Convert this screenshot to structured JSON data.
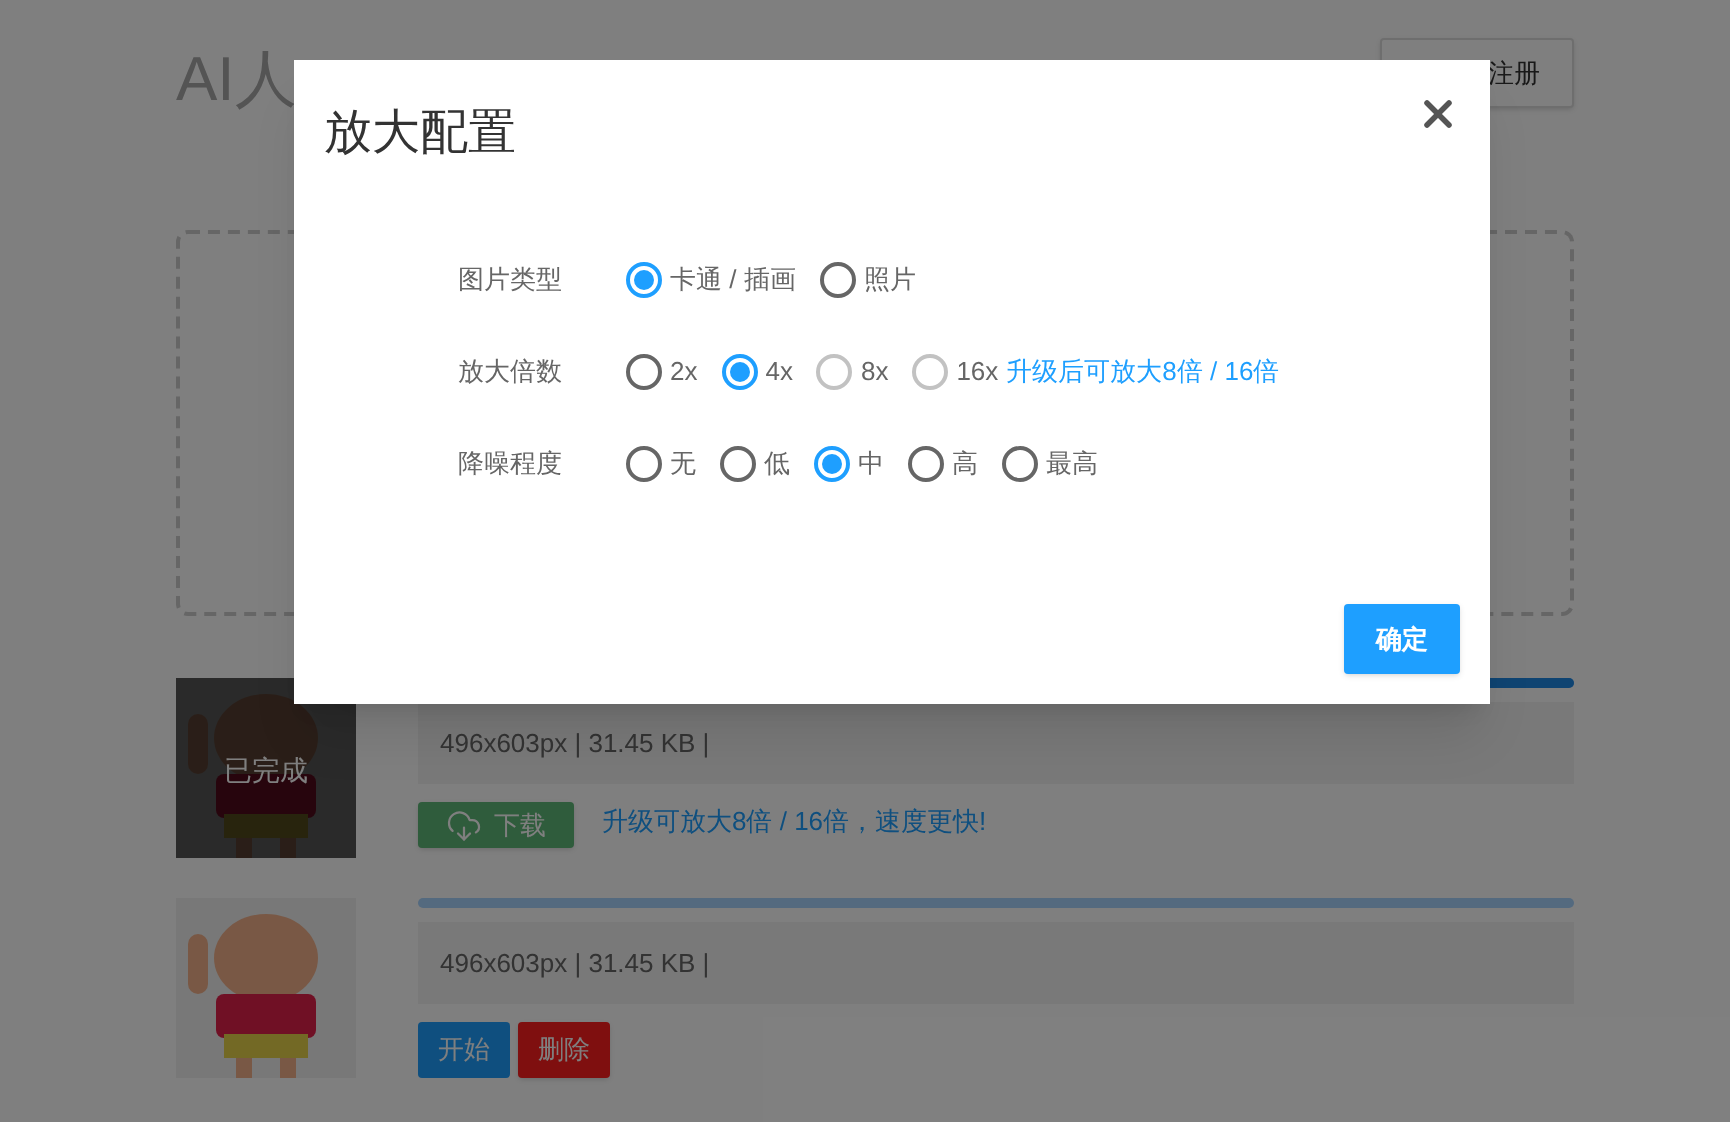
{
  "page": {
    "title": "AI人",
    "register_button": "注册"
  },
  "files": [
    {
      "completed": true,
      "status": "已完成",
      "progress": {
        "level": 1
      },
      "info": "496x603px | 31.45 KB |",
      "actions": [
        {
          "kind": "download",
          "label": "下载"
        },
        {
          "kind": "link",
          "label": "升级可放大8倍 / 16倍，速度更快!"
        }
      ]
    },
    {
      "completed": false,
      "progress": {
        "level": 0
      },
      "info": "496x603px | 31.45 KB |",
      "actions": [
        {
          "kind": "start",
          "label": "开始"
        },
        {
          "kind": "delete",
          "label": "删除"
        }
      ]
    }
  ],
  "dialog": {
    "title": "放大配置",
    "rows": [
      {
        "label": "图片类型",
        "options": [
          {
            "label": "卡通 / 插画",
            "selected": true,
            "disabled": false
          },
          {
            "label": "照片",
            "selected": false,
            "disabled": false
          }
        ]
      },
      {
        "label": "放大倍数",
        "options": [
          {
            "label": "2x",
            "selected": false,
            "disabled": false
          },
          {
            "label": "4x",
            "selected": true,
            "disabled": false
          },
          {
            "label": "8x",
            "selected": false,
            "disabled": true
          },
          {
            "label": "16x",
            "selected": false,
            "disabled": true
          }
        ],
        "note": "升级后可放大8倍 / 16倍"
      },
      {
        "label": "降噪程度",
        "options": [
          {
            "label": "无",
            "selected": false,
            "disabled": false
          },
          {
            "label": "低",
            "selected": false,
            "disabled": false
          },
          {
            "label": "中",
            "selected": true,
            "disabled": false
          },
          {
            "label": "高",
            "selected": false,
            "disabled": false
          },
          {
            "label": "最高",
            "selected": false,
            "disabled": false
          }
        ]
      }
    ],
    "confirm": "确定"
  }
}
